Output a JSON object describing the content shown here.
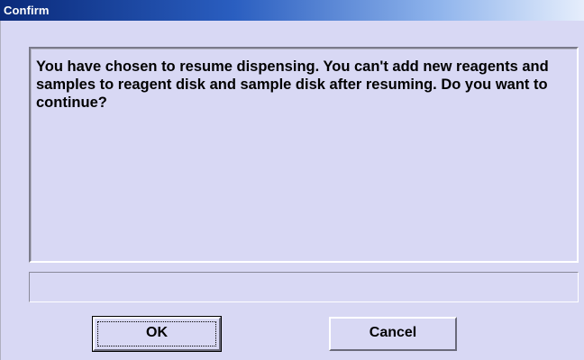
{
  "window": {
    "title": "Confirm"
  },
  "message": {
    "text": "You have chosen to resume dispensing. You can't add new reagents and samples to reagent disk and sample disk after resuming. Do you want to continue?"
  },
  "status": {
    "text": ""
  },
  "buttons": {
    "ok_label": "OK",
    "cancel_label": "Cancel"
  },
  "colors": {
    "dialog_background": "#d8d8f4",
    "titlebar_start": "#0a2a7a",
    "titlebar_end": "#e6eefc",
    "title_text": "#ffffff"
  }
}
